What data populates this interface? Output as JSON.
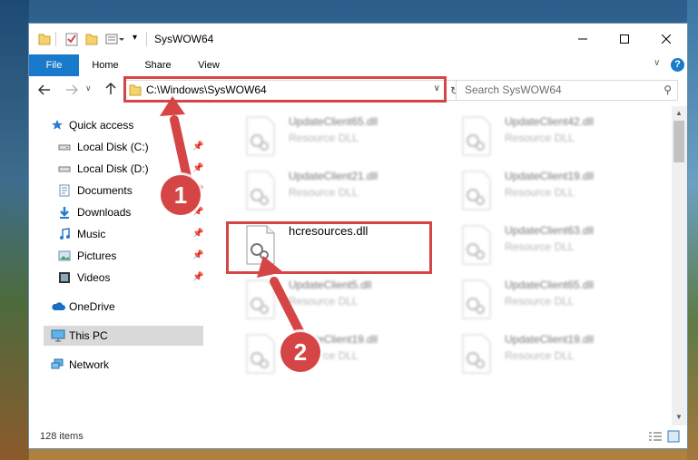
{
  "window": {
    "title": "SysWOW64"
  },
  "ribbon": {
    "tabs": [
      "File",
      "Home",
      "Share",
      "View"
    ]
  },
  "address_bar": {
    "path": "C:\\Windows\\SysWOW64"
  },
  "search": {
    "placeholder": "Search SysWOW64"
  },
  "nav_pane": {
    "items": [
      {
        "label": "Quick access",
        "icon": "star-icon"
      },
      {
        "label": "Local Disk (C:)",
        "icon": "drive-icon"
      },
      {
        "label": "Local Disk (D:)",
        "icon": "drive-icon"
      },
      {
        "label": "Documents",
        "icon": "documents-icon"
      },
      {
        "label": "Downloads",
        "icon": "download-icon"
      },
      {
        "label": "Music",
        "icon": "music-icon"
      },
      {
        "label": "Pictures",
        "icon": "pictures-icon"
      },
      {
        "label": "Videos",
        "icon": "videos-icon"
      },
      {
        "label": "OneDrive",
        "icon": "cloud-icon"
      },
      {
        "label": "This PC",
        "icon": "computer-icon"
      },
      {
        "label": "Network",
        "icon": "network-icon"
      }
    ],
    "selected": "This PC"
  },
  "files": [
    {
      "name": "UpdateClient65.dll",
      "type": "Resource DLL"
    },
    {
      "name": "UpdateClient42.dll",
      "type": "Resource DLL"
    },
    {
      "name": "UpdateClient21.dll",
      "type": "Resource DLL"
    },
    {
      "name": "UpdateClient19.dll",
      "type": "Resource DLL"
    },
    {
      "name": "hcresources.dll",
      "type": ""
    },
    {
      "name": "UpdateClient63.dll",
      "type": "Resource DLL"
    },
    {
      "name": "UpdateClient5.dll",
      "type": "Resource DLL"
    },
    {
      "name": "UpdateClient65.dll",
      "type": "Resource DLL"
    },
    {
      "name": "UpdateClient19.dll",
      "type": "Resource DLL"
    },
    {
      "name": "UpdateClient19.dll",
      "type": "Resource DLL"
    }
  ],
  "status": {
    "item_count": "128 items"
  },
  "annotations": {
    "step1": "1",
    "step2": "2",
    "color": "#d64545"
  }
}
